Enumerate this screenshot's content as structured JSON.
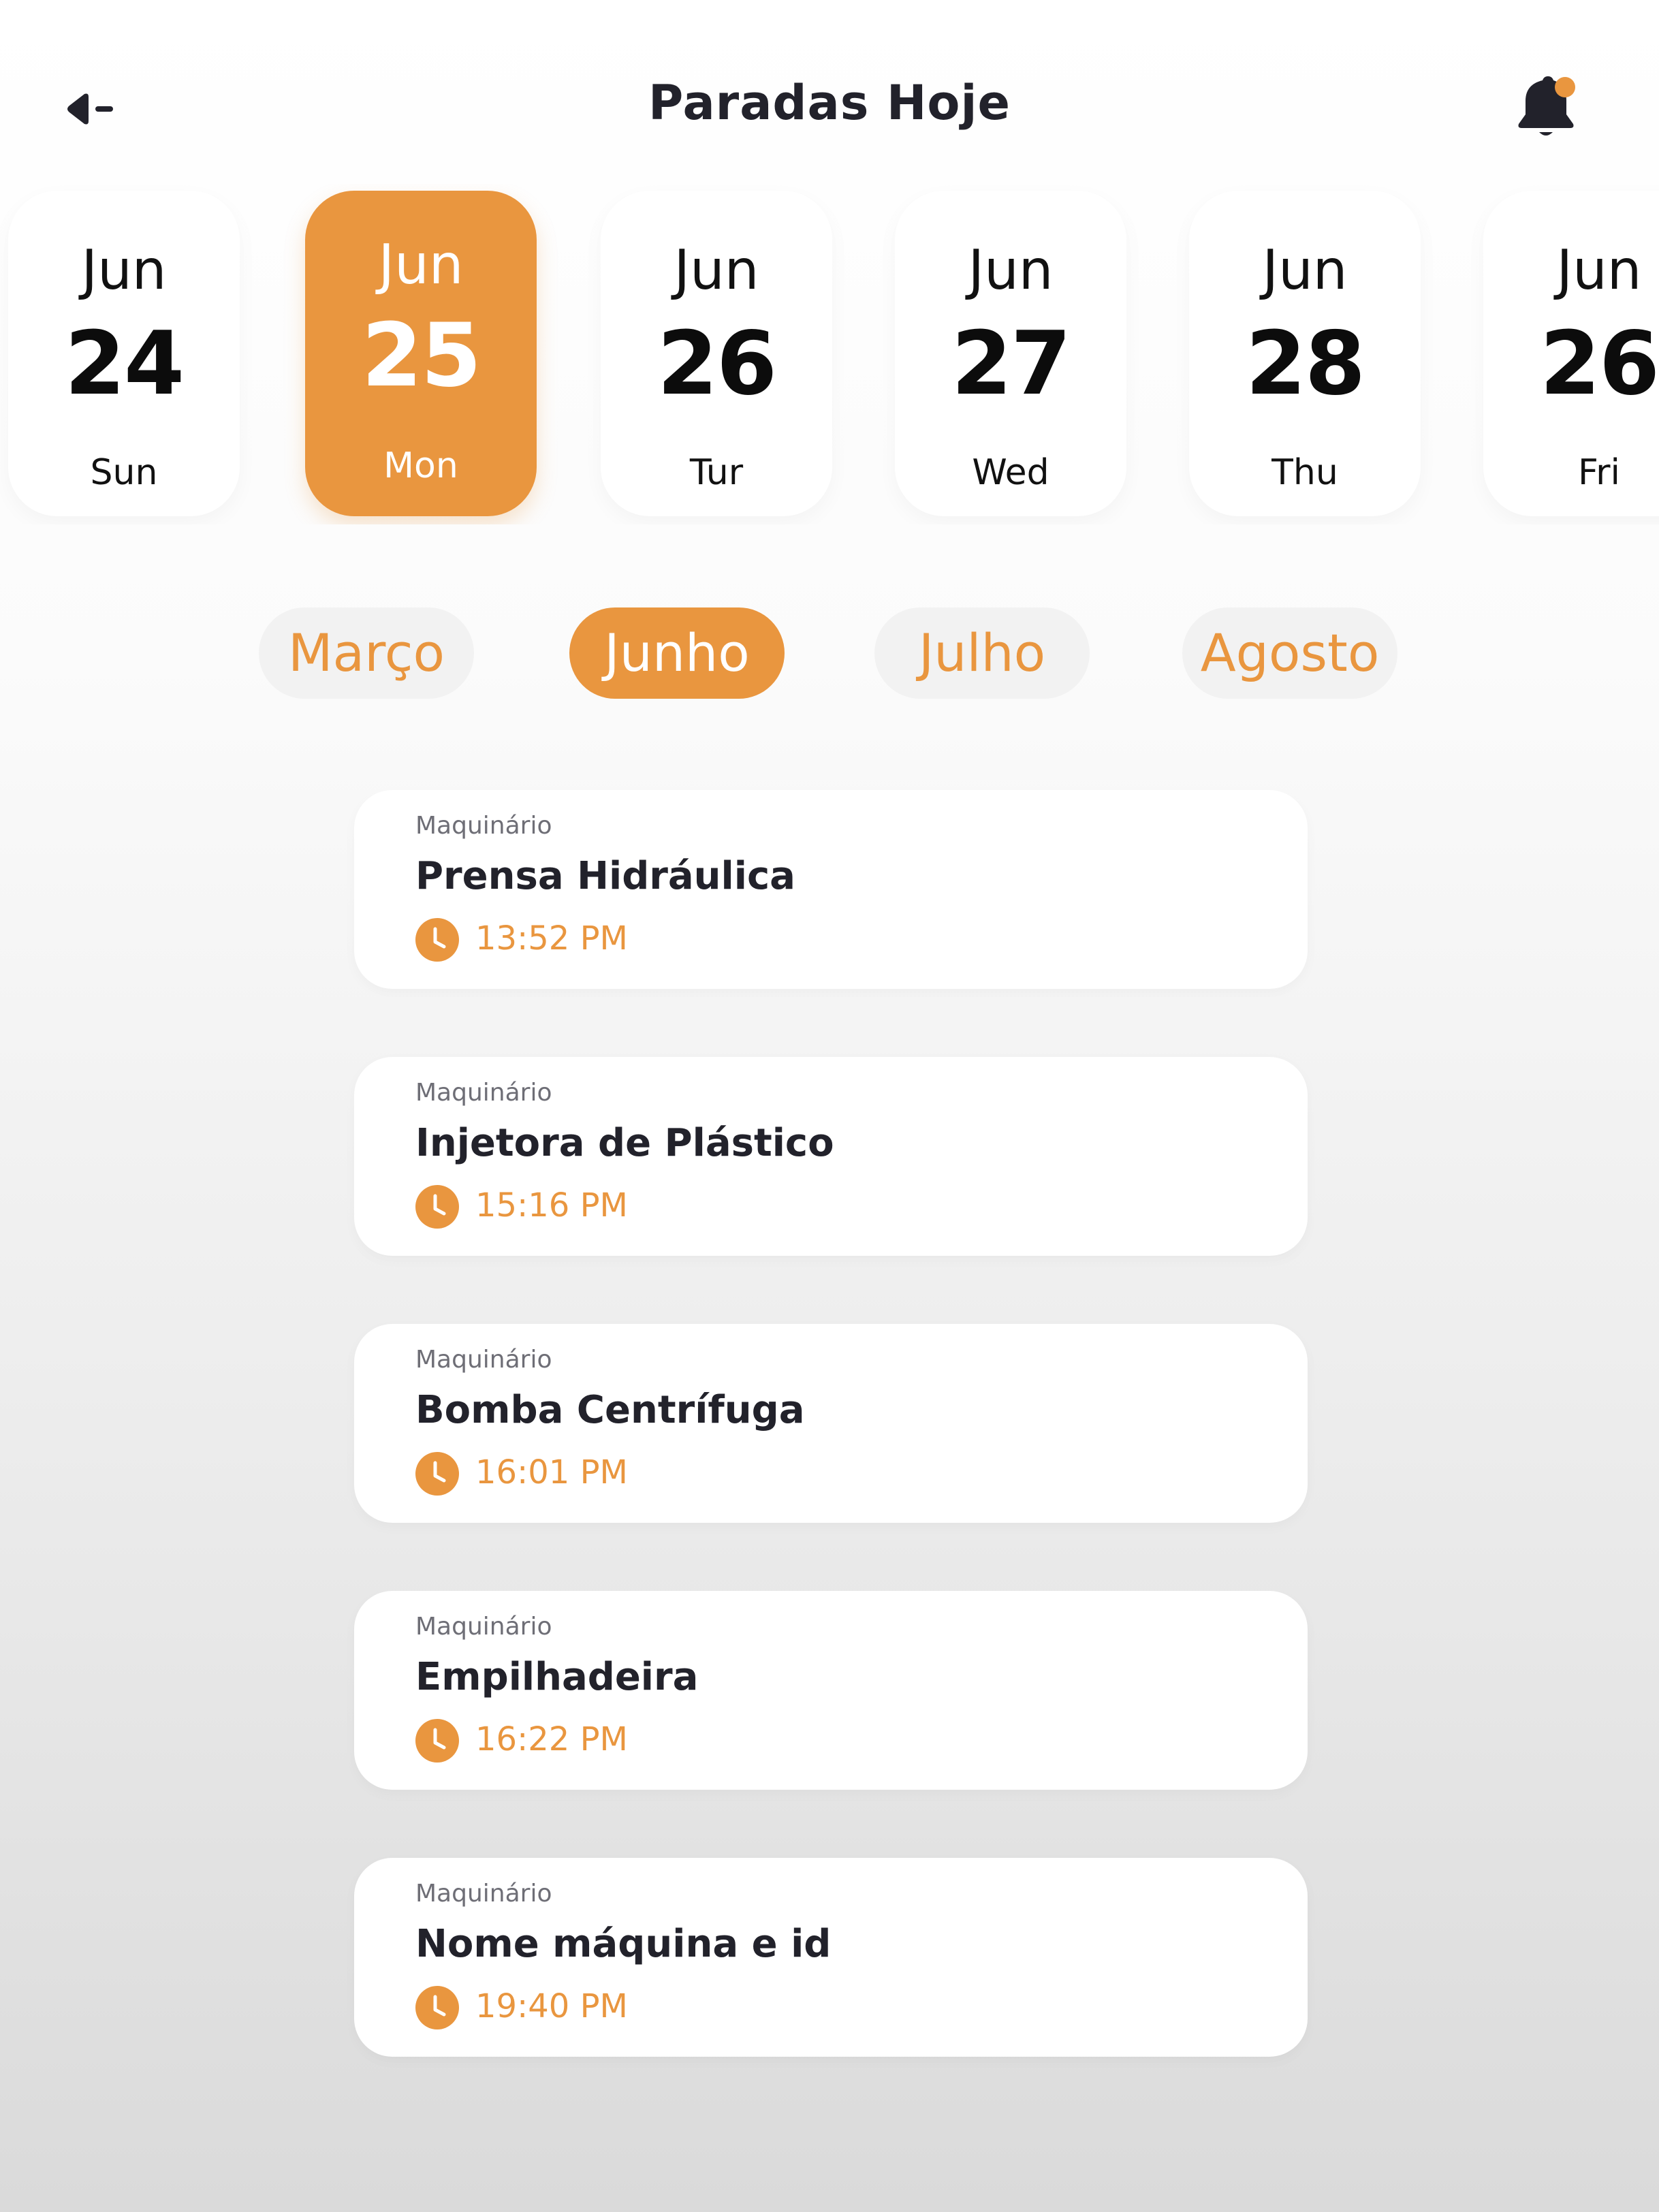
{
  "header": {
    "title": "Paradas Hoje",
    "back_icon": "back-arrow-icon",
    "bell_icon": "bell-icon",
    "has_notification": true
  },
  "dates": [
    {
      "month": "Jun",
      "day": "24",
      "weekday": "Sun",
      "selected": false
    },
    {
      "month": "Jun",
      "day": "25",
      "weekday": "Mon",
      "selected": true
    },
    {
      "month": "Jun",
      "day": "26",
      "weekday": "Tur",
      "selected": false
    },
    {
      "month": "Jun",
      "day": "27",
      "weekday": "Wed",
      "selected": false
    },
    {
      "month": "Jun",
      "day": "28",
      "weekday": "Thu",
      "selected": false
    },
    {
      "month": "Jun",
      "day": "26",
      "weekday": "Fri",
      "selected": false
    }
  ],
  "months": [
    {
      "label": "Março",
      "active": false
    },
    {
      "label": "Junho",
      "active": true
    },
    {
      "label": "Julho",
      "active": false
    },
    {
      "label": "Agosto",
      "active": false
    }
  ],
  "machines": [
    {
      "category": "Maquinário",
      "name": "Prensa Hidráulica",
      "time": "13:52 PM"
    },
    {
      "category": "Maquinário",
      "name": "Injetora de Plástico",
      "time": "15:16 PM"
    },
    {
      "category": "Maquinário",
      "name": "Bomba Centrífuga",
      "time": "16:01 PM"
    },
    {
      "category": "Maquinário",
      "name": "Empilhadeira",
      "time": "16:22 PM"
    },
    {
      "category": "Maquinário",
      "name": "Nome máquina e id",
      "time": "19:40 PM"
    }
  ],
  "colors": {
    "accent": "#e9963f",
    "text_dark": "#22222b",
    "text_muted": "#6e6e76",
    "card_bg": "#ffffff"
  }
}
